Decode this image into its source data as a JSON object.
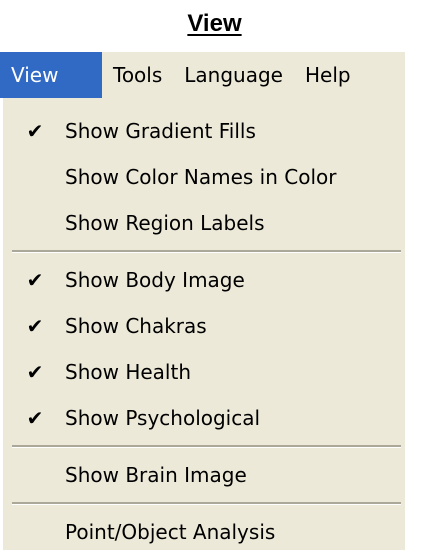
{
  "page": {
    "heading": "View"
  },
  "menubar": {
    "items": [
      {
        "label": "View",
        "active": true
      },
      {
        "label": "Tools",
        "active": false
      },
      {
        "label": "Language",
        "active": false
      },
      {
        "label": "Help",
        "active": false
      }
    ]
  },
  "view_menu": {
    "check_glyph": "✔",
    "groups": [
      [
        {
          "label": "Show Gradient Fills",
          "checked": true
        },
        {
          "label": "Show Color Names in Color",
          "checked": false
        },
        {
          "label": "Show Region Labels",
          "checked": false
        }
      ],
      [
        {
          "label": "Show Body Image",
          "checked": true
        },
        {
          "label": "Show Chakras",
          "checked": true
        },
        {
          "label": "Show Health",
          "checked": true
        },
        {
          "label": "Show Psychological",
          "checked": true
        }
      ],
      [
        {
          "label": "Show Brain Image",
          "checked": false
        }
      ],
      [
        {
          "label": "Point/Object Analysis",
          "checked": false
        }
      ]
    ]
  },
  "colors": {
    "menu_background": "#ece9d8",
    "highlight": "#316ac5",
    "separator": "#aca899"
  }
}
